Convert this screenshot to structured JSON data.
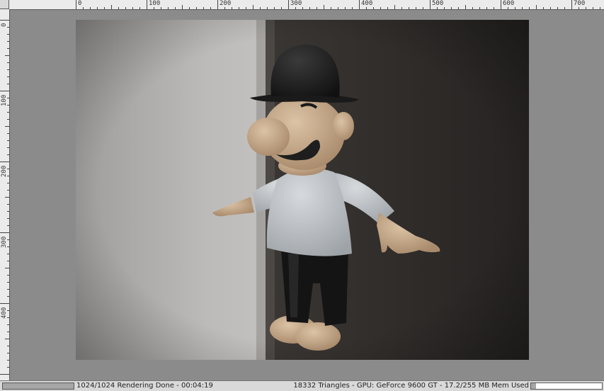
{
  "ruler": {
    "top_labels": [
      "0",
      "100",
      "200",
      "300",
      "400",
      "500",
      "600",
      "700"
    ],
    "left_labels": [
      "0",
      "100",
      "200",
      "300",
      "400"
    ]
  },
  "render": {
    "status": "1024/1024 Rendering Done - 00:04:19",
    "progress_fraction": 1.0
  },
  "stats": {
    "info": "18332 Triangles - GPU: GeForce 9600 GT - 17.2/255 MB Mem Used",
    "mem_fraction": 0.067
  },
  "colors": {
    "wall_light": "#b8b6b4",
    "wall_dark": "#2f2c2a",
    "skin": "#c9ad8e",
    "shirt": "#c8ccd0",
    "pants": "#151515",
    "hat": "#1f1f1f"
  }
}
